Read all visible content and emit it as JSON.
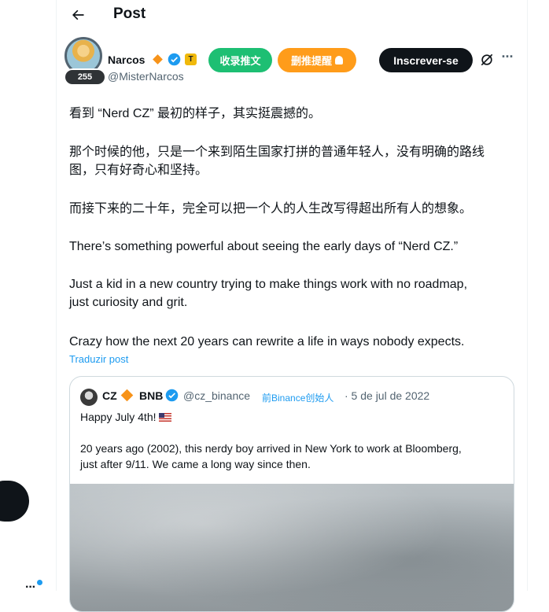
{
  "header": {
    "title": "Post"
  },
  "author": {
    "name": "Narcos",
    "handle": "@MisterNarcos",
    "avatar_badge": "255",
    "affiliate_letter": "T"
  },
  "buttons": {
    "bookmark_label": "收录推文",
    "delete_alert_label": "删推提醒",
    "subscribe_label": "Inscrever-se"
  },
  "post": {
    "paragraphs": [
      "看到 “Nerd CZ” 最初的样子，其实挺震撼的。",
      "那个时候的他，只是一个来到陌生国家打拼的普通年轻人，没有明确的路线\n图，只有好奇心和坚持。",
      "而接下来的二十年，完全可以把一个人的人生改写得超出所有人的想象。",
      "There’s something powerful about seeing the early days of “Nerd CZ.”",
      "Just a kid in a new country trying to make things work with no roadmap,\njust curiosity and grit.",
      "Crazy how the next 20 years can rewrite a life in ways nobody expects."
    ],
    "translate_label": "Traduzir post"
  },
  "quote": {
    "name": "CZ",
    "name2": "BNB",
    "handle": "@cz_binance",
    "label": "前Binance创始人",
    "date": "· 5 de jul de 2022",
    "line1": "Happy July 4th!",
    "line2": "20 years ago (2002), this nerdy boy arrived in New York to work at Bloomberg,",
    "line3": "just after 9/11. We came a long way since then."
  },
  "colors": {
    "accent": "#1d9bf0",
    "green_pill": "#1dbf73",
    "orange_pill": "#ff9c1a",
    "dark": "#0f1419",
    "muted": "#536471"
  }
}
